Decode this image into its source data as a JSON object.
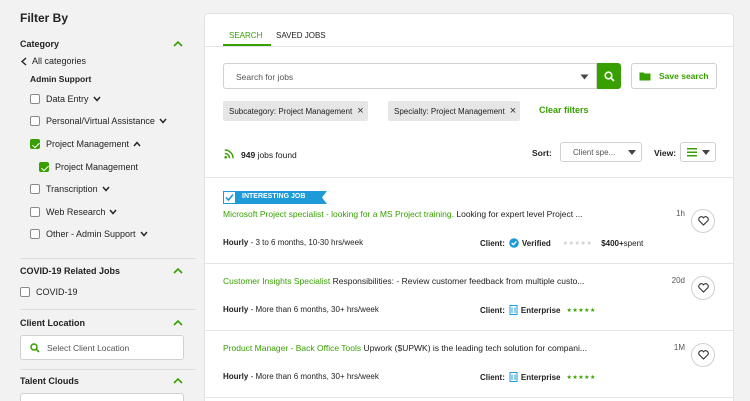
{
  "sidebar": {
    "title": "Filter By",
    "category": {
      "title": "Category",
      "back_label": "All categories",
      "group": "Admin Support",
      "items": [
        {
          "label": "Data Entry",
          "checked": false,
          "caret": "down"
        },
        {
          "label": "Personal/Virtual Assistance",
          "checked": false,
          "caret": "down"
        },
        {
          "label": "Project Management",
          "checked": true,
          "caret": "up"
        },
        {
          "label": "Project Management",
          "checked": true,
          "caret": "",
          "sub": true
        },
        {
          "label": "Transcription",
          "checked": false,
          "caret": "down"
        },
        {
          "label": "Web Research",
          "checked": false,
          "caret": "down"
        },
        {
          "label": "Other - Admin Support",
          "checked": false,
          "caret": "down"
        }
      ]
    },
    "covid": {
      "title": "COVID-19 Related Jobs",
      "item": "COVID-19"
    },
    "client_location": {
      "title": "Client Location",
      "placeholder": "Select Client Location"
    },
    "talent_clouds": {
      "title": "Talent Clouds"
    }
  },
  "main": {
    "tabs": [
      {
        "label": "SEARCH"
      },
      {
        "label": "SAVED JOBS"
      }
    ],
    "search": {
      "placeholder": "Search for jobs"
    },
    "save_search_label": "Save search",
    "chips": [
      {
        "label": "Subcategory: Project Management"
      },
      {
        "label": "Specialty: Project Management"
      }
    ],
    "clear_filters": "Clear filters",
    "results": {
      "count": "949",
      "suffix": "jobs found"
    },
    "sort": {
      "label": "Sort:",
      "value": "Client spe..."
    },
    "view": {
      "label": "View:"
    },
    "jobs": [
      {
        "badge": "INTERESTING JOB",
        "title": "Microsoft Project specialist - looking for a MS Project training.",
        "desc": " Looking for expert level Project ...",
        "age": "1h",
        "type": "Hourly",
        "duration": " - 3 to 6 months, 10-30 hrs/week",
        "client_label": "Client:",
        "client_status": "Verified",
        "spent": "$400+",
        "spent_suffix": " spent"
      },
      {
        "title": "Customer Insights Specialist",
        "desc": " Responsibilities: - Review customer feedback from multiple custo...",
        "age": "20d",
        "type": "Hourly",
        "duration": " - More than 6 months, 30+ hrs/week",
        "client_label": "Client:",
        "client_status": "Enterprise"
      },
      {
        "title": "Product Manager - Back Office Tools",
        "desc": " Upwork ($UPWK) is the leading tech solution for compani...",
        "age": "1M",
        "type": "Hourly",
        "duration": " - More than 6 months, 30+ hrs/week",
        "client_label": "Client:",
        "client_status": "Enterprise"
      }
    ]
  },
  "colors": {
    "accent": "#37a000",
    "verified": "#1d9bd8",
    "enterprise": "#1d9bd8"
  }
}
